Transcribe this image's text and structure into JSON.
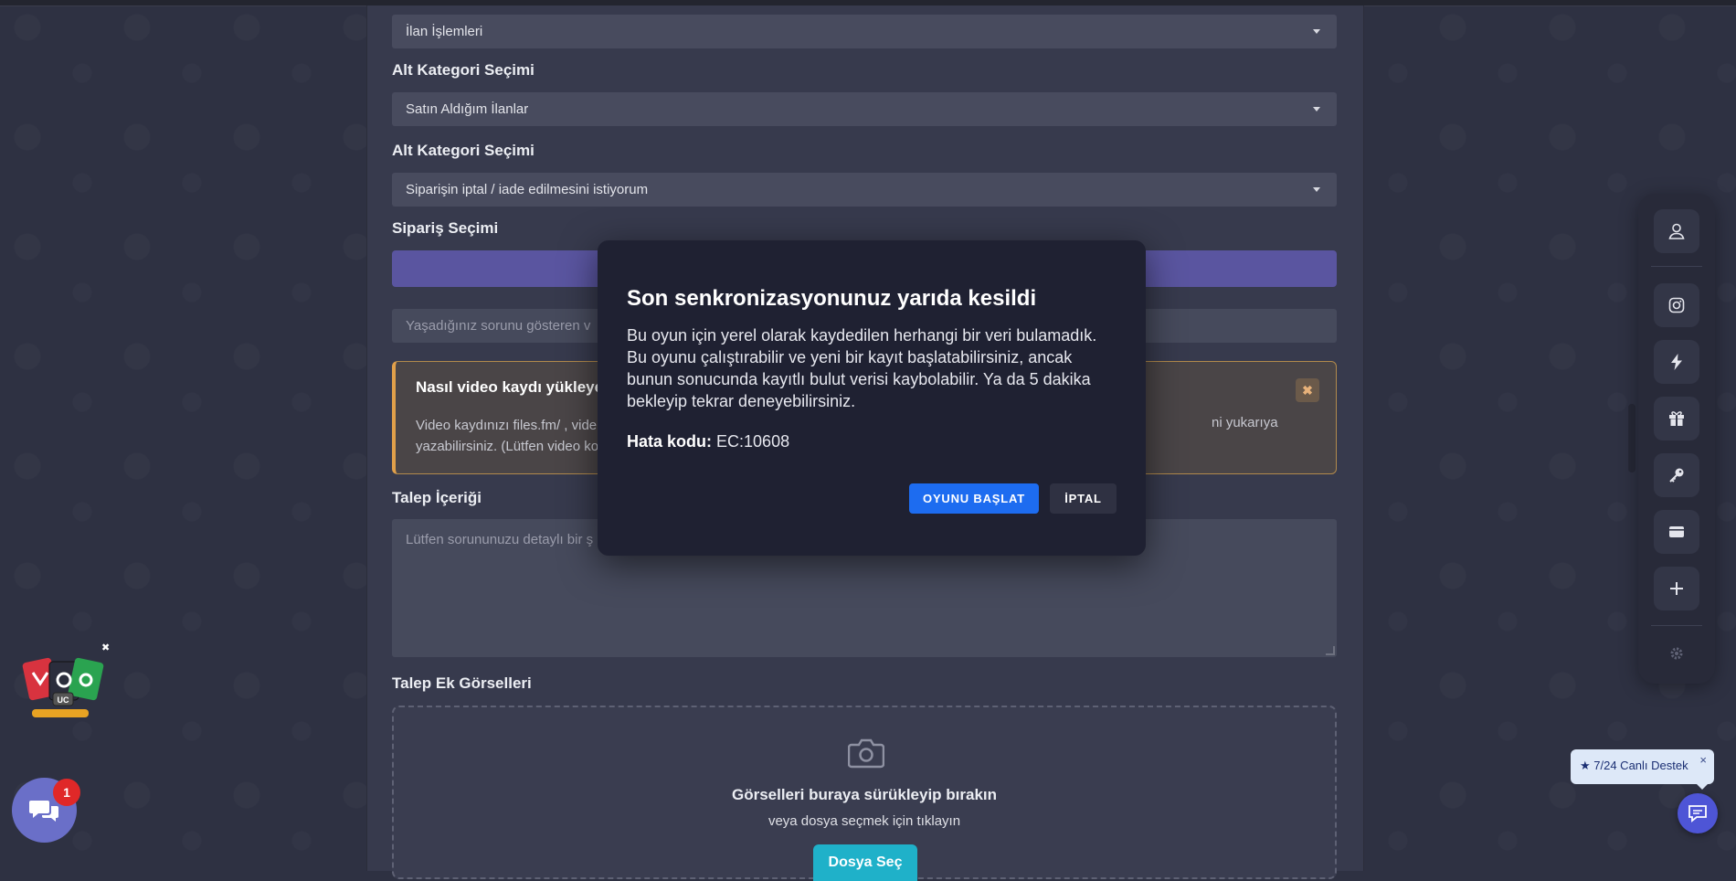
{
  "form": {
    "field1_value": "İlan İşlemleri",
    "label_alt1": "Alt Kategori Seçimi",
    "field2_value": "Satın Aldığım İlanlar",
    "label_alt2": "Alt Kategori Seçimi",
    "field3_value": "Siparişin iptal / iade edilmesini istiyorum",
    "label_siparis": "Sipariş Seçimi",
    "video_placeholder": "Yaşadığınız sorunu gösteren v",
    "warn_title": "Nasıl video kaydı yükleye",
    "warn_text_line1": "Video kaydınızı files.fm/ , vide",
    "warn_text_line2": "yazabilirsiniz. (Lütfen video ko",
    "warn_text_right": "ni yukarıya",
    "warn_close": "✖",
    "label_talep": "Talep İçeriği",
    "talep_placeholder": "Lütfen sorununuzu detaylı bir ş",
    "label_gorseller": "Talep Ek Görselleri",
    "drop_title": "Görselleri buraya sürükleyip bırakın",
    "drop_sub": "veya dosya seçmek için tıklayın",
    "drop_button": "Dosya Seç"
  },
  "dialog": {
    "title": "Son senkronizasyonunuz yarıda kesildi",
    "body": "Bu oyun için yerel olarak kaydedilen herhangi bir veri bulamadık. Bu oyunu çalıştırabilir ve yeni bir kayıt başlatabilirsiniz, ancak bunun sonucunda kayıtlı bulut verisi kaybolabilir. Ya da 5 dakika bekleyip tekrar deneyebilirsiniz.",
    "code_label": "Hata kodu:",
    "code_value": "EC:10608",
    "primary_button": "OYUNU BAŞLAT",
    "secondary_button": "İPTAL"
  },
  "dock": {
    "icons": [
      "user-icon",
      "instagram-icon",
      "bolt-icon",
      "gift-icon",
      "key-icon",
      "wallet-icon",
      "plus-icon",
      "gear-icon"
    ]
  },
  "chat": {
    "badge_count": "1"
  },
  "live_support": {
    "label": "★ 7/24 Canlı Destek",
    "close": "×"
  },
  "colors": {
    "dialog_bg": "#1f2132",
    "primary": "#1d6cf0",
    "warning_border": "#e1a04a",
    "accent_purple": "#5a55a0"
  }
}
